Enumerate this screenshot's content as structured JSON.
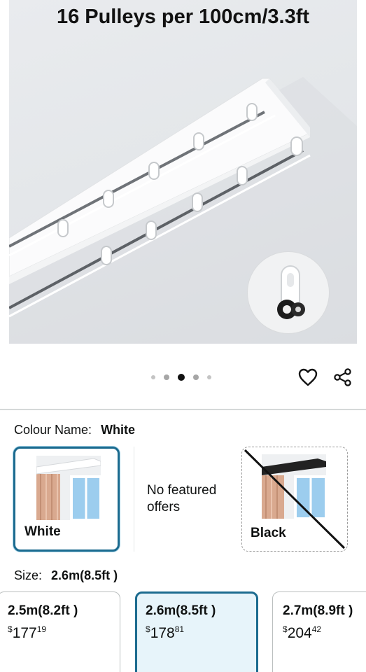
{
  "product_image": {
    "title": "16 Pulleys per 100cm/3.3ft",
    "carousel": {
      "count": 5,
      "active_index": 2
    }
  },
  "actions": {
    "favorite_icon": "heart-icon",
    "share_icon": "share-icon"
  },
  "colour": {
    "label": "Colour Name:",
    "selected": "White",
    "options": [
      {
        "name": "White",
        "selected": true,
        "available": true
      },
      {
        "name": "Black",
        "selected": false,
        "available": false
      }
    ],
    "no_offers_text": "No featured offers"
  },
  "size": {
    "label": "Size:",
    "selected": "2.6m(8.5ft )",
    "options": [
      {
        "name": "2.5m(8.2ft )",
        "currency": "$",
        "whole": "177",
        "cents": "19",
        "selected": false
      },
      {
        "name": "2.6m(8.5ft )",
        "currency": "$",
        "whole": "178",
        "cents": "81",
        "selected": true
      },
      {
        "name": "2.7m(8.9ft )",
        "currency": "$",
        "whole": "204",
        "cents": "42",
        "selected": false
      }
    ]
  },
  "colors": {
    "accent": "#1c6b8f",
    "selected_bg": "#e7f4fa",
    "divider": "#d5d9d9"
  }
}
